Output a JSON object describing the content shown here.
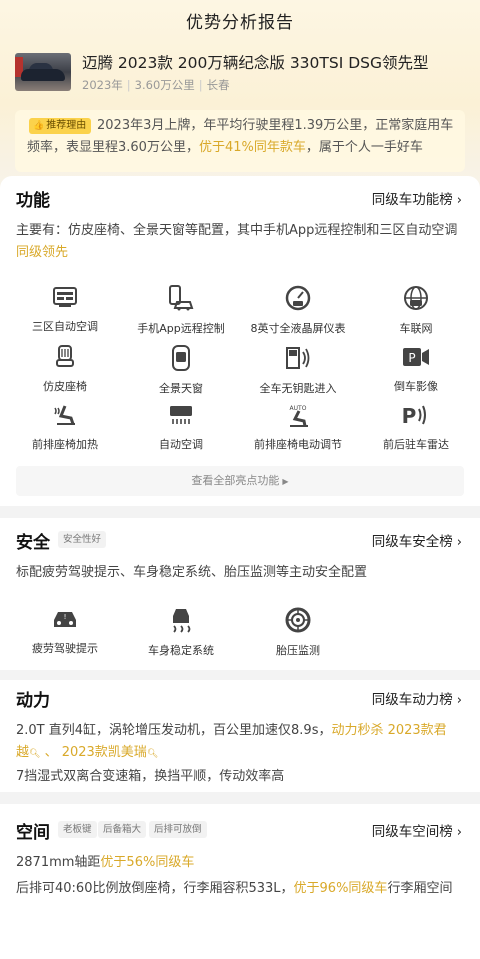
{
  "page": {
    "title": "优势分析报告"
  },
  "car": {
    "name": "迈腾 2023款 200万辆纪念版 330TSI DSG领先型",
    "year": "2023年",
    "mileage": "3.60万公里",
    "city": "长春"
  },
  "reason": {
    "badge": "推荐理由",
    "text_a": "2023年3月上牌，年平均行驶里程1.39万公里，正常家庭用车频率，表显里程3.60万公里，",
    "text_hl": "优于41%同年款车",
    "text_b": "，属于个人一手好车"
  },
  "features": {
    "title": "功能",
    "link": "同级车功能榜",
    "desc_a": "主要有：仿皮座椅、全景天窗等配置，其中手机App远程控制和三区自动空调",
    "desc_hl": "同级领先",
    "items": [
      {
        "label": "三区自动空调",
        "icon": "ac-panel-icon"
      },
      {
        "label": "手机App远程控制",
        "icon": "phone-car-icon"
      },
      {
        "label": "8英寸全液晶屏仪表",
        "icon": "lcd-gauge-icon"
      },
      {
        "label": "车联网",
        "icon": "connected-car-icon"
      },
      {
        "label": "仿皮座椅",
        "icon": "leather-seat-icon"
      },
      {
        "label": "全景天窗",
        "icon": "sunroof-icon"
      },
      {
        "label": "全车无钥匙进入",
        "icon": "keyless-entry-icon"
      },
      {
        "label": "倒车影像",
        "icon": "reverse-camera-icon"
      },
      {
        "label": "前排座椅加热",
        "icon": "seat-heat-icon"
      },
      {
        "label": "自动空调",
        "icon": "auto-ac-icon"
      },
      {
        "label": "前排座椅电动调节",
        "icon": "seat-adjust-icon"
      },
      {
        "label": "前后驻车雷达",
        "icon": "parking-radar-icon"
      }
    ],
    "more": "查看全部亮点功能"
  },
  "safety": {
    "title": "安全",
    "tag": "安全性好",
    "link": "同级车安全榜",
    "desc": "标配疲劳驾驶提示、车身稳定系统、胎压监测等主动安全配置",
    "items": [
      {
        "label": "疲劳驾驶提示",
        "icon": "fatigue-alert-icon"
      },
      {
        "label": "车身稳定系统",
        "icon": "stability-control-icon"
      },
      {
        "label": "胎压监测",
        "icon": "tire-pressure-icon"
      }
    ]
  },
  "power": {
    "title": "动力",
    "link": "同级车动力榜",
    "line1_a": "2.0T 直列4缸，涡轮增压发动机，百公里加速仅8.9s，",
    "line1_hl": "动力秒杀 2023款君",
    "line1_hl2": "越",
    "line1_sep": " 、 ",
    "line1_hl3": "2023款凯美瑞",
    "line2": "7挡湿式双离合变速箱，换挡平顺，传动效率高"
  },
  "space": {
    "title": "空间",
    "tags": [
      "老板键",
      "后备箱大",
      "后排可放倒"
    ],
    "link": "同级车空间榜",
    "line1_a": "2871mm轴距",
    "line1_hl": "优于56%同级车",
    "line2_a": "后排可40:60比例放倒座椅，行李厢容积533L，",
    "line2_hl": "优于96%同级车",
    "line2_b": "行李厢空间"
  }
}
